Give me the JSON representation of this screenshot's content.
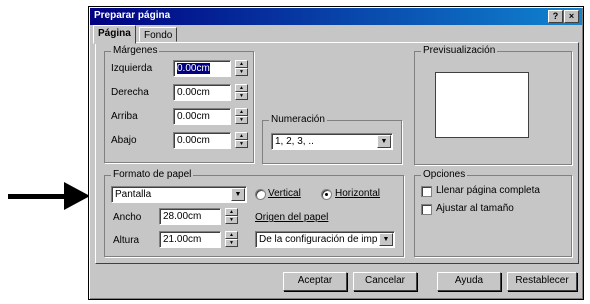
{
  "dialog": {
    "title": "Preparar página",
    "help_icon_text": "?",
    "close_icon_text": "×"
  },
  "tabs": [
    {
      "label": "Página"
    },
    {
      "label": "Fondo"
    }
  ],
  "margins": {
    "title": "Márgenes",
    "left_label": "Izquierda",
    "left_value": "0.00cm",
    "right_label": "Derecha",
    "right_value": "0.00cm",
    "top_label": "Arriba",
    "top_value": "0.00cm",
    "bottom_label": "Abajo",
    "bottom_value": "0.00cm"
  },
  "numbering": {
    "title": "Numeración",
    "value": "1, 2, 3, .."
  },
  "paper_format": {
    "title": "Formato de papel",
    "format_value": "Pantalla",
    "orientation_vertical": "Vertical",
    "orientation_horizontal": "Horizontal",
    "width_label": "Ancho",
    "width_value": "28.00cm",
    "height_label": "Altura",
    "height_value": "21.00cm",
    "source_label": "Origen del papel",
    "source_value": "De la configuración de imp"
  },
  "preview": {
    "title": "Previsualización"
  },
  "options": {
    "title": "Opciones",
    "fill_page": "Llenar página completa",
    "fit_size": "Ajustar al tamaño"
  },
  "buttons": {
    "ok": "Aceptar",
    "cancel": "Cancelar",
    "help": "Ayuda",
    "reset": "Restablecer"
  }
}
